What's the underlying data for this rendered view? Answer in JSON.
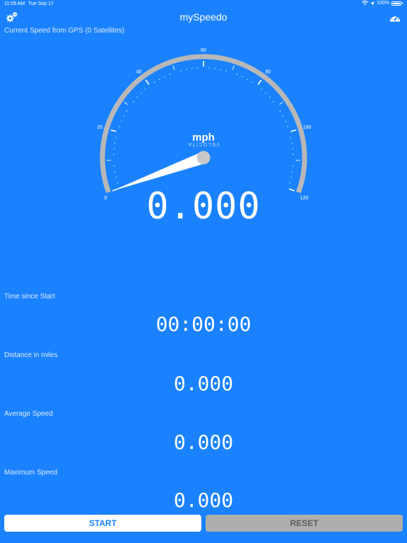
{
  "status_bar": {
    "time": "11:09 AM",
    "date": "Tue Sep 17",
    "battery": "100%"
  },
  "nav": {
    "title": "mySpeedo",
    "left_icon": "settings-gears-icon",
    "right_icon": "speedometer-icon"
  },
  "gps_label": "Current Speed from GPS (0 Satellites)",
  "gauge": {
    "unit": "mph",
    "brand": "VELOCITA",
    "min": 0,
    "max": 120,
    "labels": [
      "0",
      "20",
      "40",
      "60",
      "80",
      "100",
      "120"
    ],
    "needle_value": 0,
    "readout": "0.000"
  },
  "stats": [
    {
      "label": "Time since Start",
      "value": "00:00:00"
    },
    {
      "label": "Distance in miles",
      "value": "0.000"
    },
    {
      "label": "Average Speed",
      "value": "0.000"
    },
    {
      "label": "Maximum Speed",
      "value": "0.000"
    }
  ],
  "buttons": {
    "start": "START",
    "reset": "RESET"
  },
  "colors": {
    "background": "#1a82ff",
    "gauge_ring": "#b8b8b8",
    "start_bg": "#ffffff",
    "reset_bg": "#aeaeae"
  }
}
